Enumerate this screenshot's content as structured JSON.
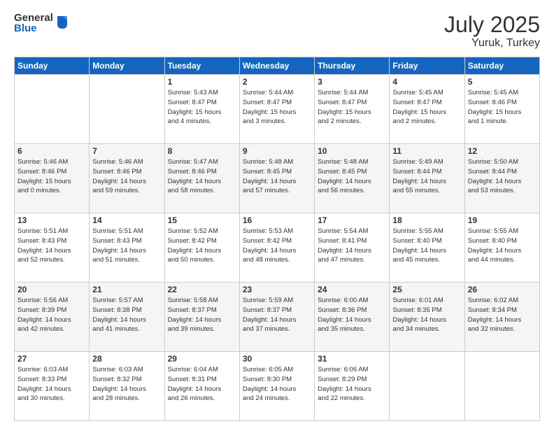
{
  "logo": {
    "general": "General",
    "blue": "Blue"
  },
  "header": {
    "month": "July 2025",
    "location": "Yuruk, Turkey"
  },
  "weekdays": [
    "Sunday",
    "Monday",
    "Tuesday",
    "Wednesday",
    "Thursday",
    "Friday",
    "Saturday"
  ],
  "weeks": [
    [
      {
        "day": "",
        "info": ""
      },
      {
        "day": "",
        "info": ""
      },
      {
        "day": "1",
        "info": "Sunrise: 5:43 AM\nSunset: 8:47 PM\nDaylight: 15 hours\nand 4 minutes."
      },
      {
        "day": "2",
        "info": "Sunrise: 5:44 AM\nSunset: 8:47 PM\nDaylight: 15 hours\nand 3 minutes."
      },
      {
        "day": "3",
        "info": "Sunrise: 5:44 AM\nSunset: 8:47 PM\nDaylight: 15 hours\nand 2 minutes."
      },
      {
        "day": "4",
        "info": "Sunrise: 5:45 AM\nSunset: 8:47 PM\nDaylight: 15 hours\nand 2 minutes."
      },
      {
        "day": "5",
        "info": "Sunrise: 5:45 AM\nSunset: 8:46 PM\nDaylight: 15 hours\nand 1 minute."
      }
    ],
    [
      {
        "day": "6",
        "info": "Sunrise: 5:46 AM\nSunset: 8:46 PM\nDaylight: 15 hours\nand 0 minutes."
      },
      {
        "day": "7",
        "info": "Sunrise: 5:46 AM\nSunset: 8:46 PM\nDaylight: 14 hours\nand 59 minutes."
      },
      {
        "day": "8",
        "info": "Sunrise: 5:47 AM\nSunset: 8:46 PM\nDaylight: 14 hours\nand 58 minutes."
      },
      {
        "day": "9",
        "info": "Sunrise: 5:48 AM\nSunset: 8:45 PM\nDaylight: 14 hours\nand 57 minutes."
      },
      {
        "day": "10",
        "info": "Sunrise: 5:48 AM\nSunset: 8:45 PM\nDaylight: 14 hours\nand 56 minutes."
      },
      {
        "day": "11",
        "info": "Sunrise: 5:49 AM\nSunset: 8:44 PM\nDaylight: 14 hours\nand 55 minutes."
      },
      {
        "day": "12",
        "info": "Sunrise: 5:50 AM\nSunset: 8:44 PM\nDaylight: 14 hours\nand 53 minutes."
      }
    ],
    [
      {
        "day": "13",
        "info": "Sunrise: 5:51 AM\nSunset: 8:43 PM\nDaylight: 14 hours\nand 52 minutes."
      },
      {
        "day": "14",
        "info": "Sunrise: 5:51 AM\nSunset: 8:43 PM\nDaylight: 14 hours\nand 51 minutes."
      },
      {
        "day": "15",
        "info": "Sunrise: 5:52 AM\nSunset: 8:42 PM\nDaylight: 14 hours\nand 50 minutes."
      },
      {
        "day": "16",
        "info": "Sunrise: 5:53 AM\nSunset: 8:42 PM\nDaylight: 14 hours\nand 48 minutes."
      },
      {
        "day": "17",
        "info": "Sunrise: 5:54 AM\nSunset: 8:41 PM\nDaylight: 14 hours\nand 47 minutes."
      },
      {
        "day": "18",
        "info": "Sunrise: 5:55 AM\nSunset: 8:40 PM\nDaylight: 14 hours\nand 45 minutes."
      },
      {
        "day": "19",
        "info": "Sunrise: 5:55 AM\nSunset: 8:40 PM\nDaylight: 14 hours\nand 44 minutes."
      }
    ],
    [
      {
        "day": "20",
        "info": "Sunrise: 5:56 AM\nSunset: 8:39 PM\nDaylight: 14 hours\nand 42 minutes."
      },
      {
        "day": "21",
        "info": "Sunrise: 5:57 AM\nSunset: 8:38 PM\nDaylight: 14 hours\nand 41 minutes."
      },
      {
        "day": "22",
        "info": "Sunrise: 5:58 AM\nSunset: 8:37 PM\nDaylight: 14 hours\nand 39 minutes."
      },
      {
        "day": "23",
        "info": "Sunrise: 5:59 AM\nSunset: 8:37 PM\nDaylight: 14 hours\nand 37 minutes."
      },
      {
        "day": "24",
        "info": "Sunrise: 6:00 AM\nSunset: 8:36 PM\nDaylight: 14 hours\nand 35 minutes."
      },
      {
        "day": "25",
        "info": "Sunrise: 6:01 AM\nSunset: 8:35 PM\nDaylight: 14 hours\nand 34 minutes."
      },
      {
        "day": "26",
        "info": "Sunrise: 6:02 AM\nSunset: 8:34 PM\nDaylight: 14 hours\nand 32 minutes."
      }
    ],
    [
      {
        "day": "27",
        "info": "Sunrise: 6:03 AM\nSunset: 8:33 PM\nDaylight: 14 hours\nand 30 minutes."
      },
      {
        "day": "28",
        "info": "Sunrise: 6:03 AM\nSunset: 8:32 PM\nDaylight: 14 hours\nand 28 minutes."
      },
      {
        "day": "29",
        "info": "Sunrise: 6:04 AM\nSunset: 8:31 PM\nDaylight: 14 hours\nand 26 minutes."
      },
      {
        "day": "30",
        "info": "Sunrise: 6:05 AM\nSunset: 8:30 PM\nDaylight: 14 hours\nand 24 minutes."
      },
      {
        "day": "31",
        "info": "Sunrise: 6:06 AM\nSunset: 8:29 PM\nDaylight: 14 hours\nand 22 minutes."
      },
      {
        "day": "",
        "info": ""
      },
      {
        "day": "",
        "info": ""
      }
    ]
  ]
}
